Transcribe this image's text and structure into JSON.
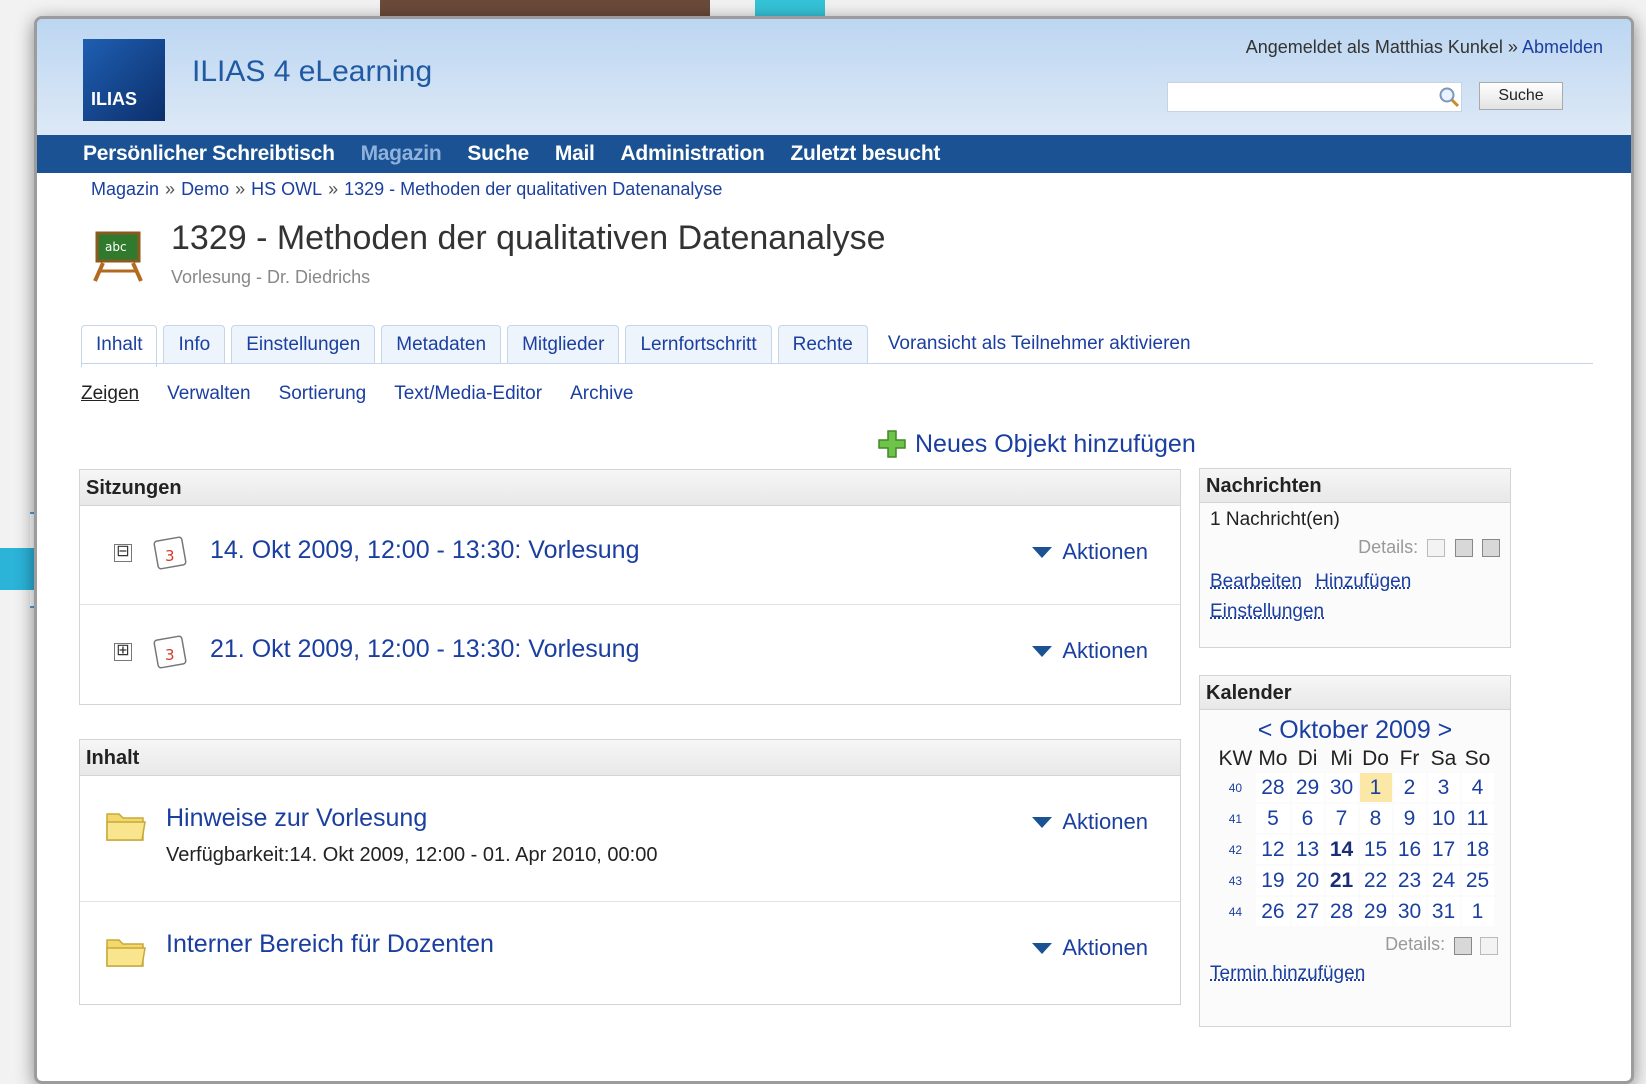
{
  "header": {
    "brand": "ILIAS 4 eLearning",
    "logo_text": "ILIAS",
    "login_prefix": "Angemeldet als Matthias Kunkel »",
    "logout_label": "Abmelden",
    "search_placeholder": "",
    "search_button": "Suche"
  },
  "mainnav": [
    "Persönlicher Schreibtisch",
    "Magazin",
    "Suche",
    "Mail",
    "Administration",
    "Zuletzt besucht"
  ],
  "mainnav_current": "Magazin",
  "breadcrumb": [
    "Magazin",
    "Demo",
    "HS OWL",
    "1329 - Methoden der qualitativen Datenanalyse"
  ],
  "page": {
    "title": "1329 - Methoden der qualitativen Datenanalyse",
    "subtitle": "Vorlesung - Dr. Diedrichs"
  },
  "tabs": [
    "Inhalt",
    "Info",
    "Einstellungen",
    "Metadaten",
    "Mitglieder",
    "Lernfortschritt",
    "Rechte"
  ],
  "tab_preview": "Voransicht als Teilnehmer aktivieren",
  "subtabs": [
    "Zeigen",
    "Verwalten",
    "Sortierung",
    "Text/Media-Editor",
    "Archive"
  ],
  "add_new": "Neues Objekt hinzufügen",
  "actions_label": "Aktionen",
  "sessions": {
    "title": "Sitzungen",
    "items": [
      {
        "label": "14. Okt 2009, 12:00 - 13:30: Vorlesung",
        "toggle": "⊟"
      },
      {
        "label": "21. Okt 2009, 12:00 - 13:30: Vorlesung",
        "toggle": "⊞"
      }
    ]
  },
  "content": {
    "title": "Inhalt",
    "items": [
      {
        "label": "Hinweise zur Vorlesung",
        "sub": "Verfügbarkeit:14. Okt 2009, 12:00 - 01. Apr 2010, 00:00"
      },
      {
        "label": "Interner Bereich für Dozenten"
      }
    ]
  },
  "news": {
    "title": "Nachrichten",
    "count": "1 Nachricht(en)",
    "details": "Details:",
    "links": [
      "Bearbeiten",
      "Hinzufügen",
      "Einstellungen"
    ]
  },
  "calendar": {
    "title": "Kalender",
    "month": "< Oktober 2009 >",
    "headers": [
      "KW",
      "Mo",
      "Di",
      "Mi",
      "Do",
      "Fr",
      "Sa",
      "So"
    ],
    "weeks": [
      [
        "40",
        "28",
        "29",
        "30",
        "1",
        "2",
        "3",
        "4"
      ],
      [
        "41",
        "5",
        "6",
        "7",
        "8",
        "9",
        "10",
        "11"
      ],
      [
        "42",
        "12",
        "13",
        "14",
        "15",
        "16",
        "17",
        "18"
      ],
      [
        "43",
        "19",
        "20",
        "21",
        "22",
        "23",
        "24",
        "25"
      ],
      [
        "44",
        "26",
        "27",
        "28",
        "29",
        "30",
        "31",
        "1"
      ]
    ],
    "today": "1",
    "highlighted": [
      "14",
      "21"
    ],
    "details": "Details:",
    "add_event": "Termin hinzufügen"
  },
  "colors": {
    "nav": "#1a5293",
    "link": "#1b3fa0",
    "today": "#fbe7a6"
  }
}
